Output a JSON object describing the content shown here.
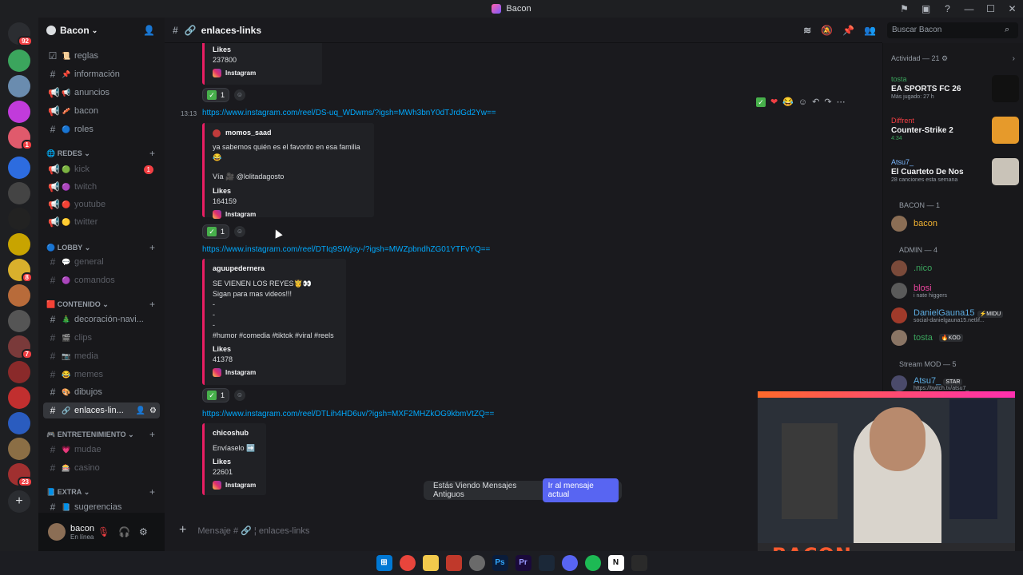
{
  "window": {
    "title": "Bacon"
  },
  "guild": {
    "name": "Bacon"
  },
  "channels": [
    {
      "icon": "📜",
      "name": "reglas",
      "muted": false
    },
    {
      "icon": "📌",
      "name": "información",
      "muted": false
    },
    {
      "icon": "📢",
      "name": "anuncios",
      "muted": false
    },
    {
      "icon": "🥓",
      "name": "bacon",
      "muted": false
    },
    {
      "icon": "🔵",
      "name": "roles",
      "muted": false
    }
  ],
  "categories": {
    "redes": "REDES",
    "lobby": "LOBBY",
    "contenido": "CONTENIDO",
    "entretenimiento": "ENTRETENIMIENTO",
    "extra": "EXTRA"
  },
  "redes": [
    "kick",
    "twitch",
    "youtube",
    "twitter"
  ],
  "redes_badge": "1",
  "lobby": [
    "general",
    "comandos"
  ],
  "contenido": [
    "decoración-navi...",
    "clips",
    "media",
    "memes",
    "dibujos",
    "enlaces-lin..."
  ],
  "entretenimiento": [
    "mudae",
    "casino"
  ],
  "extra": [
    "sugerencias"
  ],
  "user": {
    "name": "bacon",
    "status": "En línea"
  },
  "channel_header": {
    "name": "enlaces-links"
  },
  "search": {
    "placeholder": "Buscar Bacon"
  },
  "messages": {
    "m0": {
      "likes_label": "Likes",
      "likes": "237800",
      "source": "Instagram",
      "react_count": "1"
    },
    "m1": {
      "time": "13:13",
      "url": "https://www.instagram.com/reel/DS-uq_WDwms/?igsh=MWh3bnY0dTJrdGd2Yw==",
      "author": "momos_saad",
      "text": "ya sabemos quién es el favorito en esa familia 😂",
      "via": "Vía 🎥 @lolitadagosto",
      "likes_label": "Likes",
      "likes": "164159",
      "source": "Instagram",
      "react_count": "1"
    },
    "m2": {
      "url": "https://www.instagram.com/reel/DTIq9SWjoy-/?igsh=MWZpbndhZG01YTFvYQ==",
      "author": "aguupedernera",
      "text": "SE VIENEN LOS REYES🤴👀",
      "text2": "Sigan para mas videos!!!",
      "dash1": "-",
      "dash2": "-",
      "dash3": "-",
      "tags": "#humor #comedia #tiktok #viral #reels",
      "likes_label": "Likes",
      "likes": "41378",
      "source": "Instagram",
      "react_count": "1"
    },
    "m3": {
      "url": "https://www.instagram.com/reel/DTLih4HD6uv/?igsh=MXF2MHZkOG9kbmVtZQ==",
      "author": "chicoshub",
      "text": "Envíaselo ➡️",
      "likes_label": "Likes",
      "likes": "22601",
      "source": "Instagram"
    }
  },
  "notice": {
    "text": "Estás Viendo Mensajes Antiguos",
    "button": "Ir al mensaje actual"
  },
  "input": {
    "placeholder": "Mensaje # 🔗 ¦ enlaces-links"
  },
  "activity": {
    "header": "Actividad — 21 ⚙",
    "items": [
      {
        "name": "tosta",
        "game": "EA SPORTS FC 26",
        "sub": "Más jugado: 27 h",
        "color": "#3ba55d"
      },
      {
        "name": "Diffrent",
        "game": "Counter-Strike 2",
        "sub": "4:34",
        "color": "#f23f43"
      },
      {
        "name": "Atsu7_",
        "game": "El Cuarteto De Nos",
        "sub": "28 canciones esta semana",
        "color": "#7ab7ff"
      }
    ]
  },
  "roles": [
    {
      "title": "BACON — 1",
      "members": [
        {
          "name": "bacon",
          "color": "#f0b232"
        }
      ]
    },
    {
      "title": "ADMIN — 4",
      "members": [
        {
          "name": ".nico",
          "color": "#3ba55d"
        },
        {
          "name": "blosi",
          "color": "#eb459e",
          "sub": "i nate higgers"
        },
        {
          "name": "DanielGauna15",
          "color": "#5dade2",
          "tag": "⚡MIDU",
          "sub": "social-danielgauna15.netlif..."
        },
        {
          "name": "tosta",
          "color": "#3ba55d",
          "tag": "🔥KOD"
        }
      ]
    },
    {
      "title": "Stream MOD — 5",
      "members": [
        {
          "name": "Atsu7_",
          "color": "#5dade2",
          "tag": "STAR",
          "sub": "https://twitch.tv/atsu7_"
        }
      ]
    }
  ],
  "cam": {
    "brand": "BACON"
  }
}
